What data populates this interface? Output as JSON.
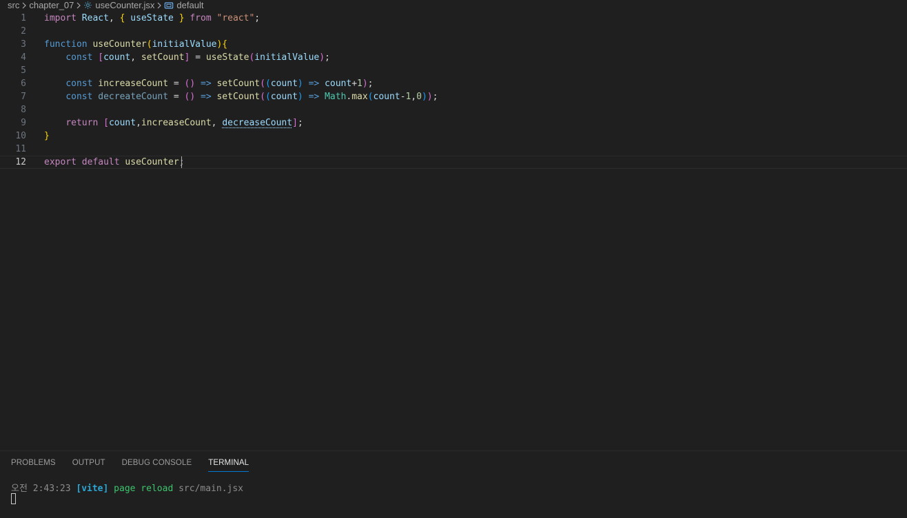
{
  "breadcrumb": {
    "items": [
      {
        "label": "src"
      },
      {
        "label": "chapter_07"
      },
      {
        "label": "useCounter.jsx",
        "icon": "gear-icon"
      },
      {
        "label": "default",
        "icon": "symbol-variable-icon"
      }
    ]
  },
  "editor": {
    "line_numbers": [
      "1",
      "2",
      "3",
      "4",
      "5",
      "6",
      "7",
      "8",
      "9",
      "10",
      "11",
      "12"
    ],
    "active_line": 12,
    "lines": [
      "import React, { useState } from \"react\";",
      "",
      "function useCounter(initialValue){",
      "    const [count, setCount] = useState(initialValue);",
      "",
      "    const increaseCount = () => setCount((count) => count+1);",
      "    const decreateCount = () => setCount((count) => Math.max(count-1,0));",
      "",
      "    return [count,increaseCount, decreaseCount];",
      "}",
      "",
      "export default useCounter;"
    ]
  },
  "panel": {
    "tabs": [
      {
        "label": "PROBLEMS",
        "active": false
      },
      {
        "label": "OUTPUT",
        "active": false
      },
      {
        "label": "DEBUG CONSOLE",
        "active": false
      },
      {
        "label": "TERMINAL",
        "active": true
      }
    ],
    "terminal": {
      "time_prefix": "오전",
      "time": "2:43:23",
      "tag": "[vite]",
      "message": "page reload",
      "path": "src/main.jsx"
    }
  },
  "colors": {
    "background": "#1f1f1f",
    "keyword": "#c586c0",
    "storage": "#569cd6",
    "function": "#dcdcaa",
    "variable": "#9cdcfe",
    "string": "#ce9178",
    "number": "#b5cea8",
    "tab_active_underline": "#0078d4"
  }
}
